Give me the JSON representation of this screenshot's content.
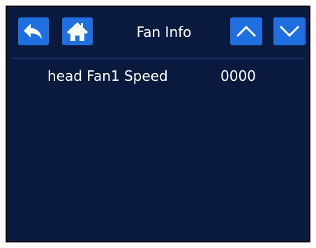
{
  "header": {
    "title": "Fan Info",
    "back_icon": "back-arrow-icon",
    "home_icon": "home-icon",
    "up_icon": "chevron-up-icon",
    "down_icon": "chevron-down-icon"
  },
  "rows": [
    {
      "label": "head Fan1 Speed",
      "value": "0000"
    }
  ],
  "colors": {
    "background": "#0a1a3e",
    "button": "#1f6fe0",
    "text": "#ffffff"
  }
}
